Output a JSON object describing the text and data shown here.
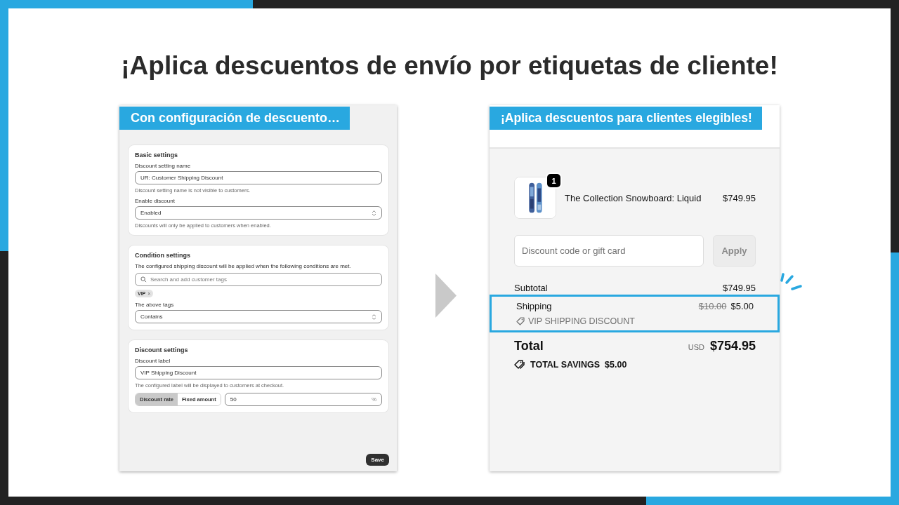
{
  "title": "¡Aplica descuentos de envío por etiquetas de cliente!",
  "settings_panel": {
    "banner": "Con configuración de descuento…",
    "sections": [
      {
        "heading": "Basic settings",
        "fields": [
          {
            "kind": "text",
            "label": "Discount setting name",
            "value": "UR: Customer Shipping Discount",
            "help": "Discount setting name is not visible to customers."
          },
          {
            "kind": "select",
            "label": "Enable discount",
            "value": "Enabled",
            "help": "Discounts will only be applied to customers when enabled."
          }
        ]
      },
      {
        "heading": "Condition settings",
        "description": "The configured shipping discount will be applied when the following conditions are met.",
        "fields": [
          {
            "kind": "search",
            "placeholder": "Search and add customer tags",
            "tags": [
              {
                "label": "VIP",
                "remove": "×"
              }
            ]
          },
          {
            "kind": "select",
            "label": "The above tags",
            "value": "Contains"
          }
        ]
      },
      {
        "heading": "Discount settings",
        "fields": [
          {
            "kind": "text",
            "label": "Discount label",
            "value": "VIP Shipping Discount",
            "help": "The configured label will be displayed to customers at checkout."
          },
          {
            "kind": "amount",
            "options": [
              {
                "label": "Discount rate",
                "selected": true
              },
              {
                "label": "Fixed amount",
                "selected": false
              }
            ],
            "value": "50",
            "suffix": "%"
          }
        ]
      }
    ],
    "save_button": "Save"
  },
  "checkout_panel": {
    "banner": "¡Aplica descuentos para clientes elegibles!",
    "product": {
      "quantity": "1",
      "name": "The Collection Snowboard: Liquid",
      "price": "$749.95"
    },
    "discount_field": {
      "placeholder": "Discount code or gift card"
    },
    "apply_button": "Apply",
    "subtotal": {
      "label": "Subtotal",
      "value": "$749.95"
    },
    "shipping": {
      "label": "Shipping",
      "original_price": "$10.00",
      "price": "$5.00",
      "discount_label": "VIP SHIPPING DISCOUNT",
      "highlighted": true
    },
    "total": {
      "label": "Total",
      "currency": "USD",
      "value": "$754.95"
    },
    "savings": {
      "label": "TOTAL SAVINGS",
      "value": "$5.00"
    }
  }
}
